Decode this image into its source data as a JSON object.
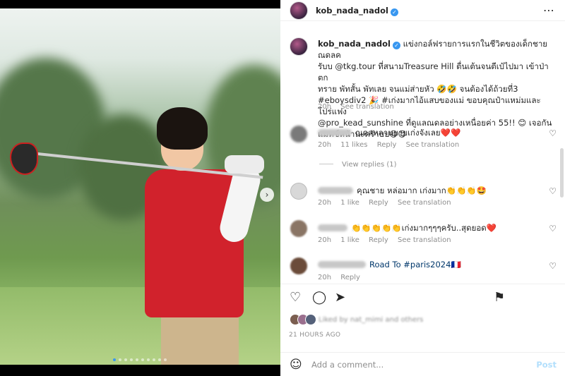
{
  "post": {
    "username": "kob_nada_nadol",
    "caption_lines": [
      "แข่งกอล์ฟรายการแรกในชีวิตของเด็กชายณดลค",
      "รับบ @tkg.tour ที่สนามTreasure Hill ตื่นเต้นจนตีเป๋ไปมา เข้าป่า ตก",
      "ทราย พัทสั้น พัทเลย จนแม่ส่ายหัว 🤣🤣 จนต้องได้ถ้วยที่3",
      "#eboysdiv2 🎉 #เก่งมากไอ้แสบของแม่ ขอบคุณป๋าแหม่มและโปร่แฟง",
      "@pro_kead_sunshine ที่ดูแลณดลอย่างเหนื่อยค่า 55!! 😊 เจอกัน",
      "แมทช์หน้านะคร้าบบ😋😋"
    ],
    "caption_time": "20h",
    "see_translation": "See translation"
  },
  "comments": [
    {
      "text": "ณดลหลานยายเก่งจังเลย❤️❤️",
      "time": "20h",
      "likes": "11 likes",
      "reply": "Reply",
      "translate": "See translation",
      "view_replies": "View replies (1)"
    },
    {
      "text": "คุณชาย หล่อมาก เก่งมาก👏👏👏🤩",
      "time": "20h",
      "likes": "1 like",
      "reply": "Reply",
      "translate": "See translation"
    },
    {
      "text": "👏👏👏👏👏เก่งมากๆๆๆครับ..สุดยอด❤️",
      "time": "20h",
      "likes": "1 like",
      "reply": "Reply",
      "translate": "See translation"
    },
    {
      "text": "Road To #paris2024🇫🇷",
      "time": "20h",
      "reply": "Reply"
    }
  ],
  "likes_text": "Liked by nat_mimi and others",
  "time_ago": "21 HOURS AGO",
  "add_comment": {
    "placeholder": "Add a comment...",
    "post_label": "Post"
  },
  "icons": {
    "more": "more-icon",
    "heart": "heart-icon",
    "comment": "comment-icon",
    "share": "share-icon",
    "save": "bookmark-icon",
    "emoji": "emoji-icon",
    "next": "chevron-right-icon",
    "verified": "verified-badge-icon"
  },
  "colors": {
    "link": "#00376b",
    "verified": "#3897f0",
    "post": "#b2dffc",
    "heart_red": "#ed4956"
  }
}
